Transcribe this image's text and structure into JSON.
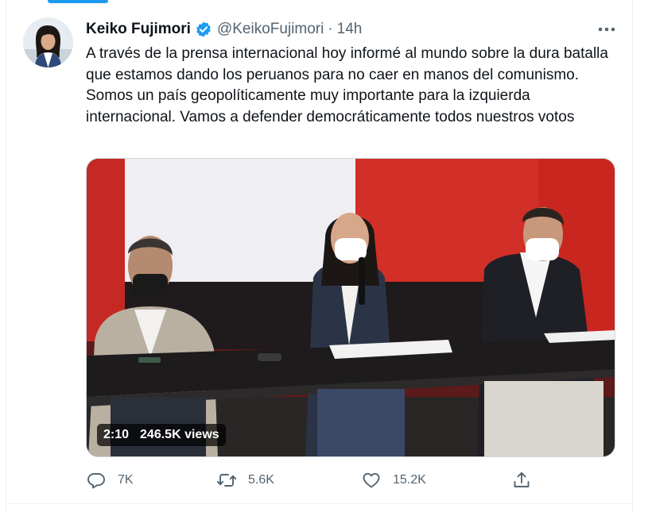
{
  "tweet": {
    "author": {
      "display_name": "Keiko Fujimori",
      "handle": "@KeikoFujimori",
      "verified": true,
      "verified_color": "#1d9bf0"
    },
    "separator": "·",
    "time": "14h",
    "text": "A través de la prensa internacional hoy informé al mundo sobre la dura batalla que estamos dando los peruanos para no caer en manos del comunismo. Somos un país geopolíticamente muy importante para la izquierda internacional. Vamos a defender democráticamente todos nuestros votos",
    "media": {
      "type": "video",
      "duration": "2:10",
      "views": "246.5K views"
    },
    "actions": {
      "reply": {
        "icon": "reply-icon",
        "count": "7K"
      },
      "retweet": {
        "icon": "retweet-icon",
        "count": "5.6K"
      },
      "like": {
        "icon": "heart-icon",
        "count": "15.2K"
      },
      "share": {
        "icon": "share-icon"
      }
    }
  },
  "colors": {
    "text_primary": "#0f1419",
    "text_secondary": "#536471",
    "accent": "#1d9bf0"
  }
}
